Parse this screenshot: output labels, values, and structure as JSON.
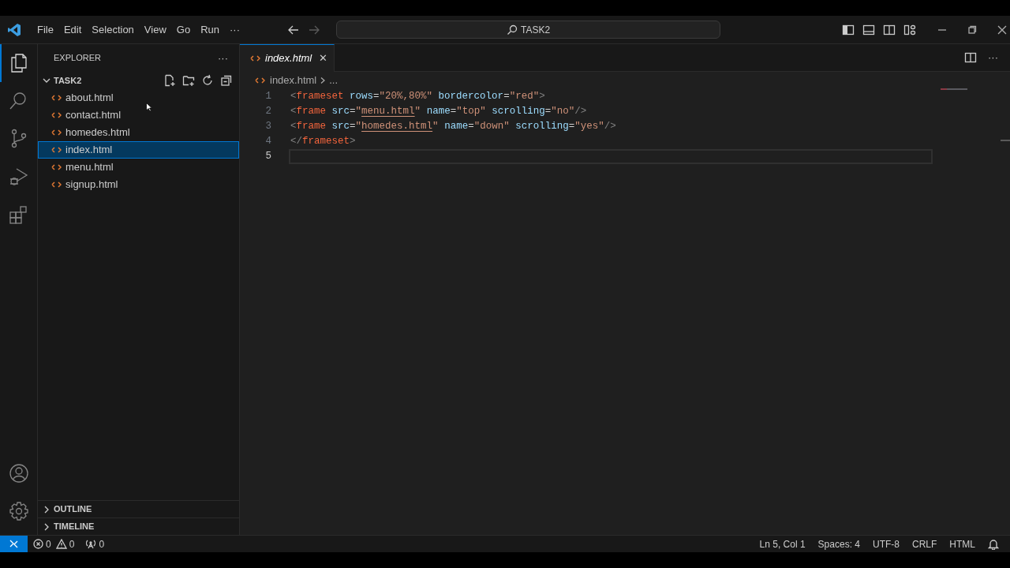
{
  "menu_bar": [
    "File",
    "Edit",
    "Selection",
    "View",
    "Go",
    "Run",
    "···"
  ],
  "command_center": {
    "text": "TASK2"
  },
  "activity_bar": [
    {
      "kind": "files",
      "selected": true
    },
    {
      "kind": "search",
      "selected": false
    },
    {
      "kind": "source-control",
      "selected": false
    },
    {
      "kind": "run-debug",
      "selected": false
    },
    {
      "kind": "extensions",
      "selected": false
    }
  ],
  "activity_bar_bottom": [
    {
      "kind": "account"
    },
    {
      "kind": "settings"
    }
  ],
  "sidebar": {
    "title": "EXPLORER",
    "more": "···",
    "folder": {
      "name": "TASK2",
      "expanded": true,
      "files": [
        {
          "name": "about.html",
          "selected": false
        },
        {
          "name": "contact.html",
          "selected": false
        },
        {
          "name": "homedes.html",
          "selected": false
        },
        {
          "name": "index.html",
          "selected": true
        },
        {
          "name": "menu.html",
          "selected": false
        },
        {
          "name": "signup.html",
          "selected": false
        }
      ]
    },
    "panels": [
      {
        "name": "OUTLINE",
        "expanded": false
      },
      {
        "name": "TIMELINE",
        "expanded": false
      }
    ]
  },
  "tabs": [
    {
      "label": "index.html",
      "selected": true,
      "close": "✕"
    }
  ],
  "editor_actions": {
    "more": "···"
  },
  "breadcrumb": {
    "file": "index.html",
    "rest": "..."
  },
  "code_lines": [
    {
      "number": "1",
      "current": false,
      "text": "<frameset rows=\"20%,80%\" bordercolor=\"red\">"
    },
    {
      "number": "2",
      "current": false,
      "text": "<frame src=\"menu.html\" name=\"top\" scrolling=\"no\"/>"
    },
    {
      "number": "3",
      "current": false,
      "text": "<frame src=\"homedes.html\" name=\"down\" scrolling=\"yes\"/>"
    },
    {
      "number": "4",
      "current": false,
      "text": "</frameset>"
    },
    {
      "number": "5",
      "current": true
    }
  ],
  "status_bar": {
    "errors": "0",
    "warnings": "0",
    "ports": "0",
    "right": [
      "Ln 5, Col 1",
      "Spaces: 4",
      "UTF-8",
      "CRLF",
      "HTML"
    ]
  }
}
